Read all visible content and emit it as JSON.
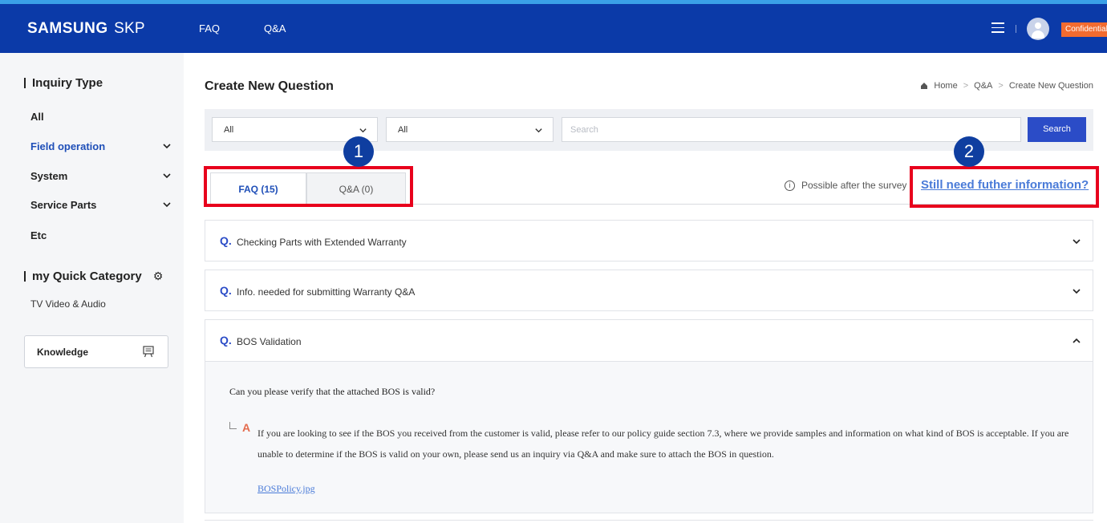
{
  "header": {
    "logo_brand": "SAMSUNG",
    "logo_suffix": "SKP",
    "nav": [
      "FAQ",
      "Q&A"
    ],
    "confidential_badge": "Confidential",
    "accent_color": "#0b3aa8"
  },
  "sidebar": {
    "inquiry_title": "Inquiry Type",
    "items": [
      {
        "label": "All",
        "expandable": false,
        "active": false
      },
      {
        "label": "Field operation",
        "expandable": true,
        "active": true
      },
      {
        "label": "System",
        "expandable": true,
        "active": false
      },
      {
        "label": "Service Parts",
        "expandable": true,
        "active": false
      },
      {
        "label": "Etc",
        "expandable": false,
        "active": false
      }
    ],
    "quick_title": "my Quick Category",
    "quick_items": [
      "TV Video & Audio"
    ],
    "knowledge_label": "Knowledge"
  },
  "main": {
    "title": "Create New Question",
    "breadcrumb": [
      "Home",
      "Q&A",
      "Create New Question"
    ],
    "filters": {
      "select1_value": "All",
      "select2_value": "All",
      "search_placeholder": "Search",
      "search_button": "Search"
    },
    "tabs": [
      {
        "label": "FAQ (15)",
        "active": true
      },
      {
        "label": "Q&A (0)",
        "active": false
      }
    ],
    "callouts": [
      "1",
      "2"
    ],
    "survey_note": "Possible after the survey",
    "more_info_link": "Still need futher information?",
    "faqs": [
      {
        "q": "Q.",
        "title": "Checking Parts with Extended Warranty",
        "expanded": false
      },
      {
        "q": "Q.",
        "title": "Info. needed for submitting Warranty Q&A",
        "expanded": false
      },
      {
        "q": "Q.",
        "title": "BOS Validation",
        "expanded": true
      }
    ],
    "answer": {
      "question": "Can you please verify that the attached BOS is valid?",
      "a_mark": "A",
      "text": "If you are looking to see if the BOS you received from the customer is valid, please refer to our policy guide section 7.3, where we provide samples and information on what kind of BOS is acceptable. If you are unable to determine if the BOS is valid on your own, please send us an inquiry via Q&A and make sure to attach the BOS in question.",
      "attachment": "BOSPolicy.jpg"
    }
  }
}
